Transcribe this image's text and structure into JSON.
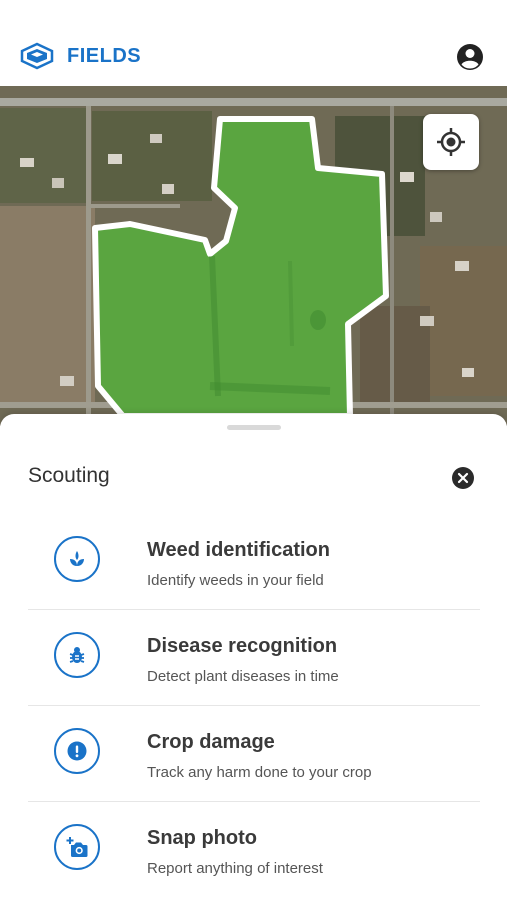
{
  "header": {
    "title": "FIELDS",
    "logo_icon": "field-logo-icon",
    "account_icon": "account-circle-icon"
  },
  "map": {
    "locate_icon": "gps-locate-icon",
    "field_color": "#5aa540"
  },
  "sheet": {
    "title": "Scouting",
    "close_icon": "close-circle-icon",
    "options": [
      {
        "title": "Weed identification",
        "subtitle": "Identify weeds in your field",
        "icon": "sprout-icon"
      },
      {
        "title": "Disease recognition",
        "subtitle": "Detect plant diseases in time",
        "icon": "bug-icon"
      },
      {
        "title": "Crop damage",
        "subtitle": "Track any harm done to your crop",
        "icon": "alert-icon"
      },
      {
        "title": "Snap photo",
        "subtitle": "Report anything of interest",
        "icon": "add-photo-icon"
      }
    ]
  },
  "colors": {
    "accent": "#1a73c8",
    "field_fill": "#5aa540"
  }
}
